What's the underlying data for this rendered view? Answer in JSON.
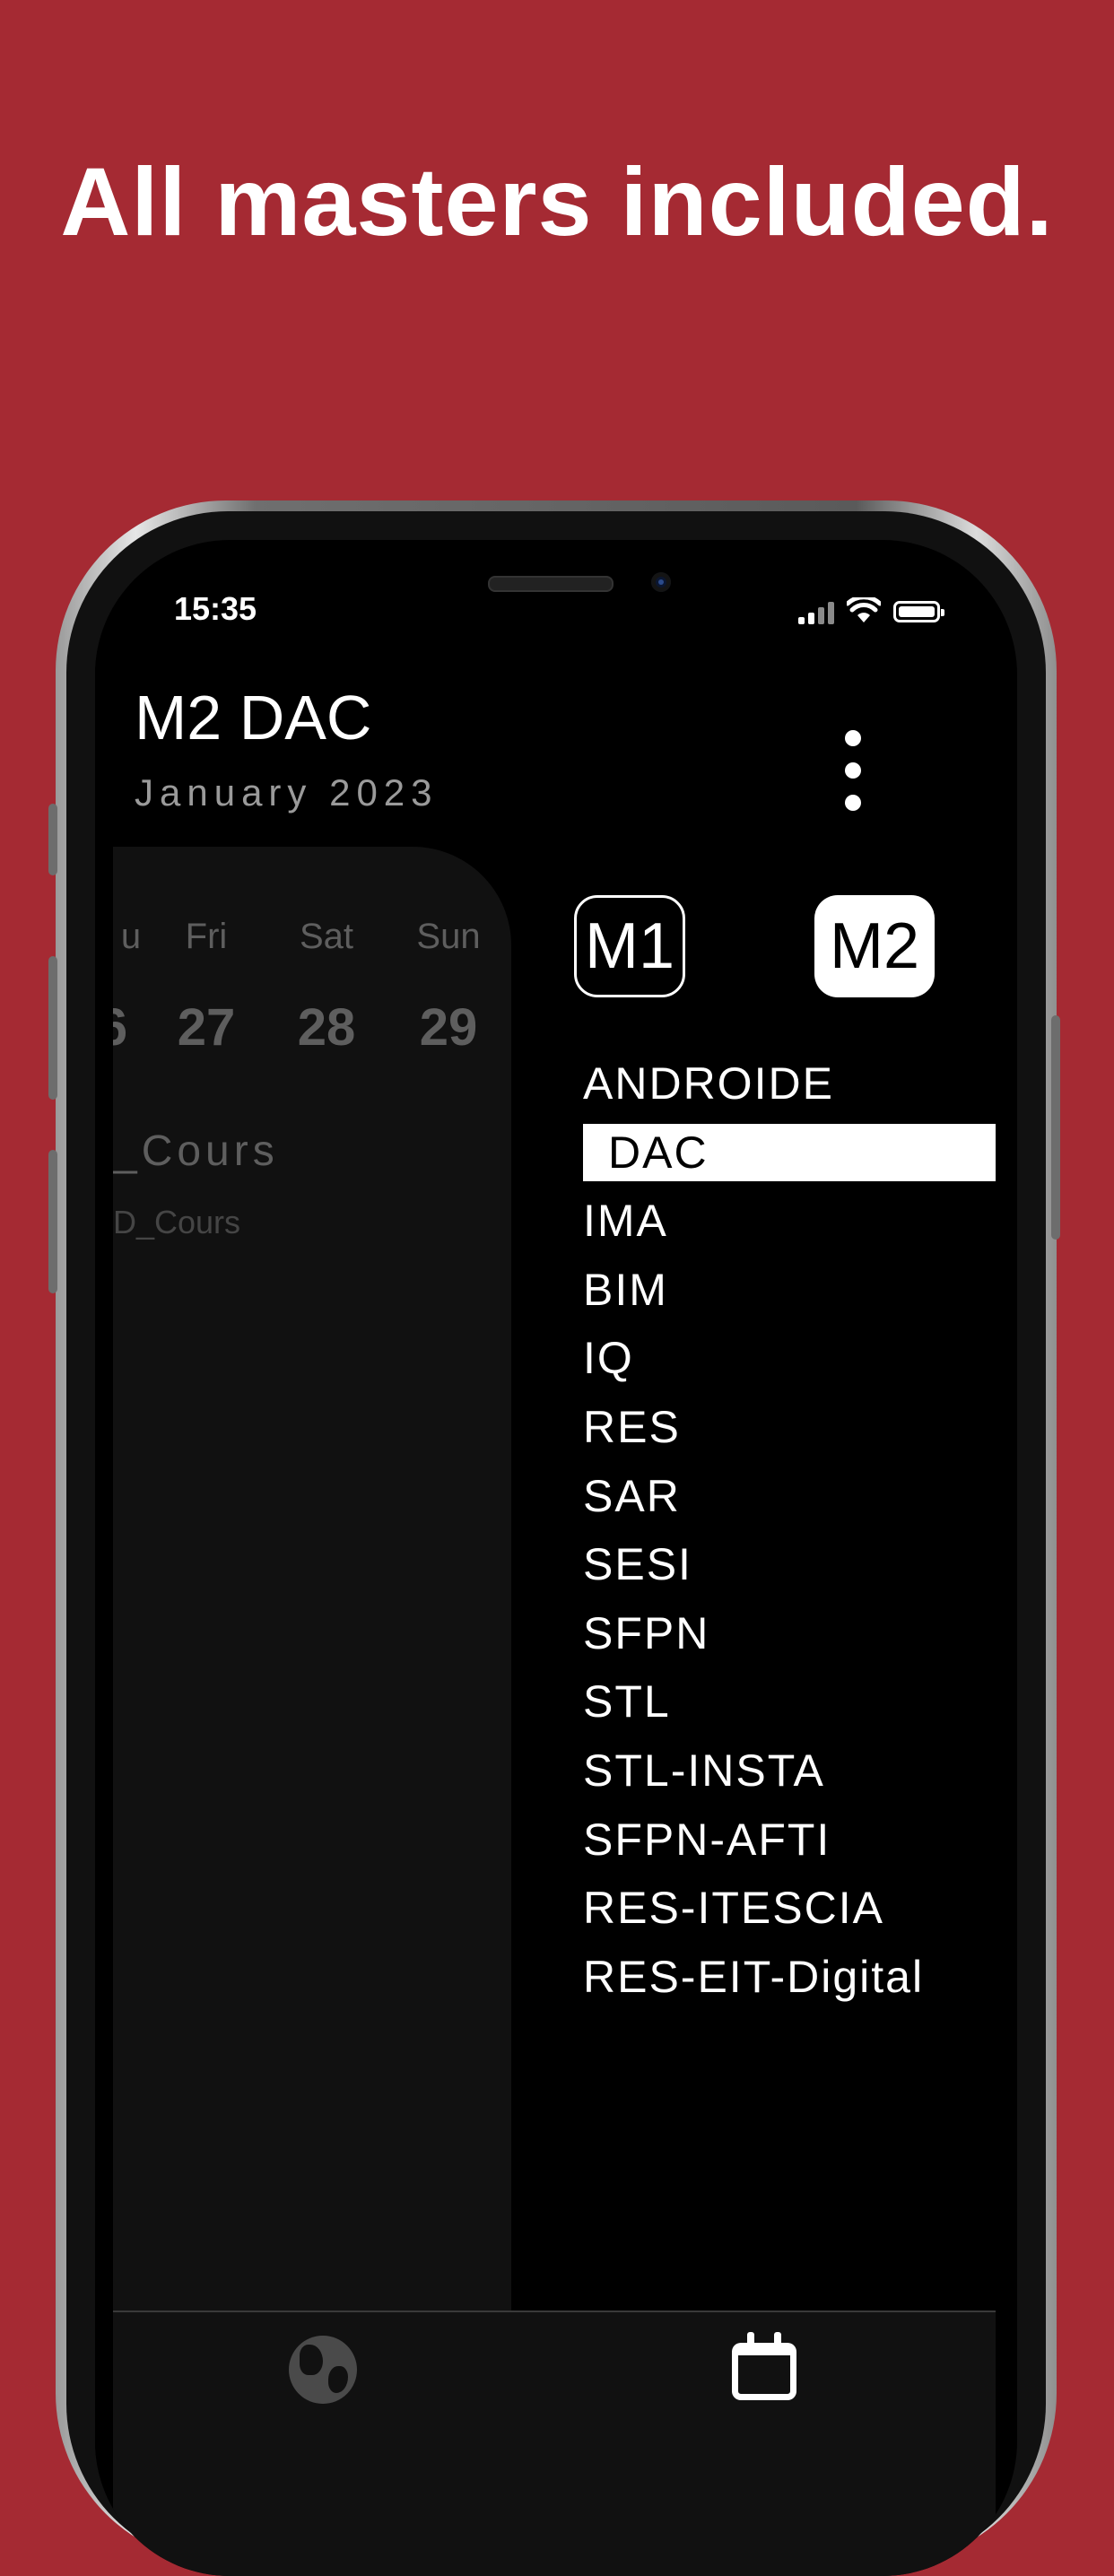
{
  "headline": "All masters included.",
  "status_bar": {
    "time": "15:35"
  },
  "header": {
    "title": "M2 DAC",
    "subtitle": "January  2023"
  },
  "calendar": {
    "day_names": [
      "u",
      "Fri",
      "Sat",
      "Sun"
    ],
    "day_numbers": [
      "6",
      "27",
      "28",
      "29"
    ],
    "event_title": "_Cours",
    "event_subtitle": "D_Cours"
  },
  "drawer": {
    "levels": [
      {
        "label": "M1",
        "selected": false
      },
      {
        "label": "M2",
        "selected": true
      }
    ],
    "masters": [
      {
        "label": "ANDROIDE",
        "selected": false
      },
      {
        "label": "DAC",
        "selected": true
      },
      {
        "label": "IMA",
        "selected": false
      },
      {
        "label": "BIM",
        "selected": false
      },
      {
        "label": "IQ",
        "selected": false
      },
      {
        "label": "RES",
        "selected": false
      },
      {
        "label": "SAR",
        "selected": false
      },
      {
        "label": "SESI",
        "selected": false
      },
      {
        "label": "SFPN",
        "selected": false
      },
      {
        "label": "STL",
        "selected": false
      },
      {
        "label": "STL-INSTA",
        "selected": false
      },
      {
        "label": "SFPN-AFTI",
        "selected": false
      },
      {
        "label": "RES-ITESCIA",
        "selected": false
      },
      {
        "label": "RES-EIT-Digital",
        "selected": false
      }
    ]
  },
  "bottom_nav": {
    "items": [
      "globe-icon",
      "calendar-icon"
    ]
  },
  "colors": {
    "background": "#a52a33",
    "screen": "#000000",
    "panel": "#111111"
  }
}
